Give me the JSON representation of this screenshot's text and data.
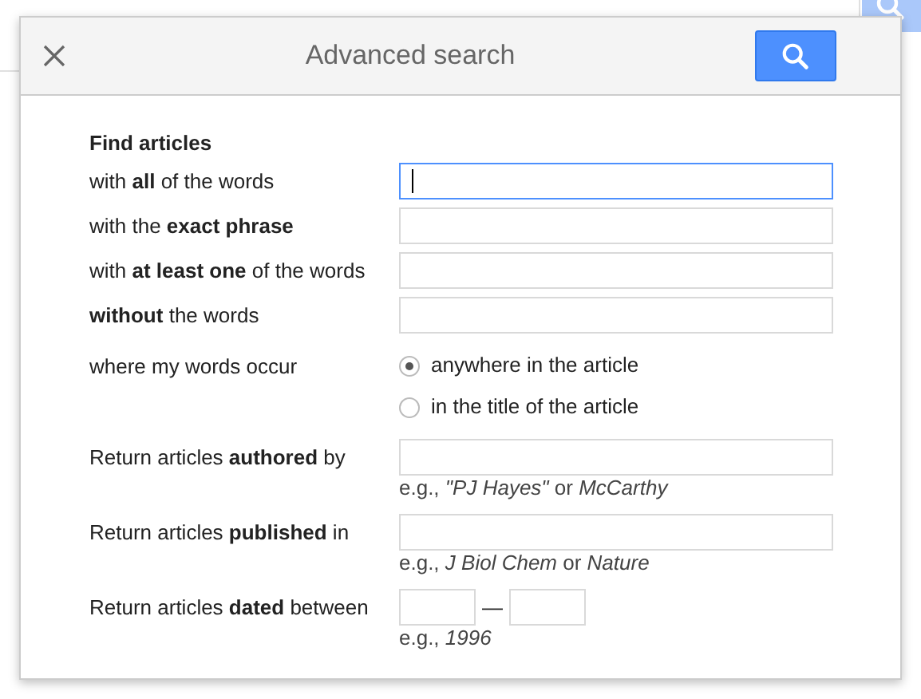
{
  "dialog": {
    "title": "Advanced search"
  },
  "section_title": "Find articles",
  "word_fields": [
    {
      "label": "with **all** of the words",
      "focused": true
    },
    {
      "label": "with the **exact phrase**",
      "focused": false
    },
    {
      "label": "with **at least one** of the words",
      "focused": false
    },
    {
      "label": "**without** the words",
      "focused": false
    }
  ],
  "occurrence": {
    "label": "where my words occur",
    "options": [
      {
        "label": "anywhere in the article",
        "selected": true
      },
      {
        "label": "in the title of the article",
        "selected": false
      }
    ]
  },
  "filters": [
    {
      "kind": "text",
      "label": "Return articles **authored** by",
      "hint": "e.g., *\"PJ Hayes\"* or *McCarthy*"
    },
    {
      "kind": "text",
      "label": "Return articles **published** in",
      "hint": "e.g., *J Biol Chem* or *Nature*"
    },
    {
      "kind": "range",
      "label": "Return articles **dated** between",
      "separator": "—",
      "hint": "e.g., *1996*"
    }
  ]
}
